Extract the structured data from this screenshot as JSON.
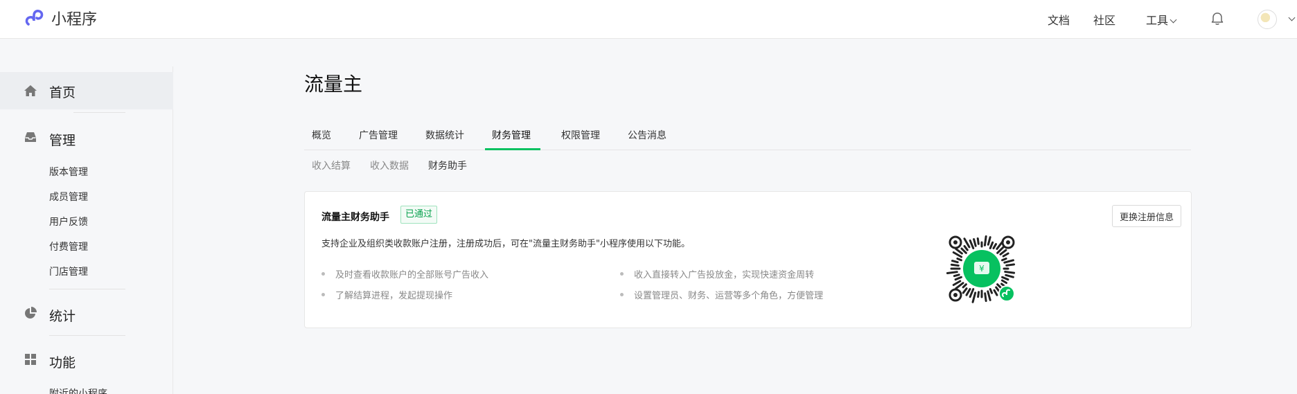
{
  "header": {
    "brand": "小程序",
    "nav": {
      "docs": "文档",
      "community": "社区",
      "tools": "工具"
    }
  },
  "sidebar": {
    "home": "首页",
    "manage": {
      "label": "管理",
      "items": [
        "版本管理",
        "成员管理",
        "用户反馈",
        "付费管理",
        "门店管理"
      ]
    },
    "stats": "统计",
    "features": {
      "label": "功能",
      "items": [
        "附近的小程序"
      ]
    }
  },
  "page": {
    "title": "流量主",
    "tabs": [
      "概览",
      "广告管理",
      "数据统计",
      "财务管理",
      "权限管理",
      "公告消息"
    ],
    "active_tab": "财务管理",
    "subtabs": [
      "收入结算",
      "收入数据",
      "财务助手"
    ],
    "active_subtab": "财务助手"
  },
  "card": {
    "title": "流量主财务助手",
    "status_badge": "已通过",
    "description": "支持企业及组织类收款账户注册，注册成功后，可在\"流量主财务助手\"小程序使用以下功能。",
    "features": [
      "及时查看收款账户的全部账号广告收入",
      "收入直接转入广告投放金，实现快速资金周转",
      "了解结算进程，发起提现操作",
      "设置管理员、财务、运营等多个角色，方便管理"
    ],
    "change_button": "更换注册信息",
    "qr_symbol": "¥"
  },
  "colors": {
    "accent": "#07c160",
    "brand_logo": "#6467f0",
    "badge_text": "#07a14d"
  }
}
